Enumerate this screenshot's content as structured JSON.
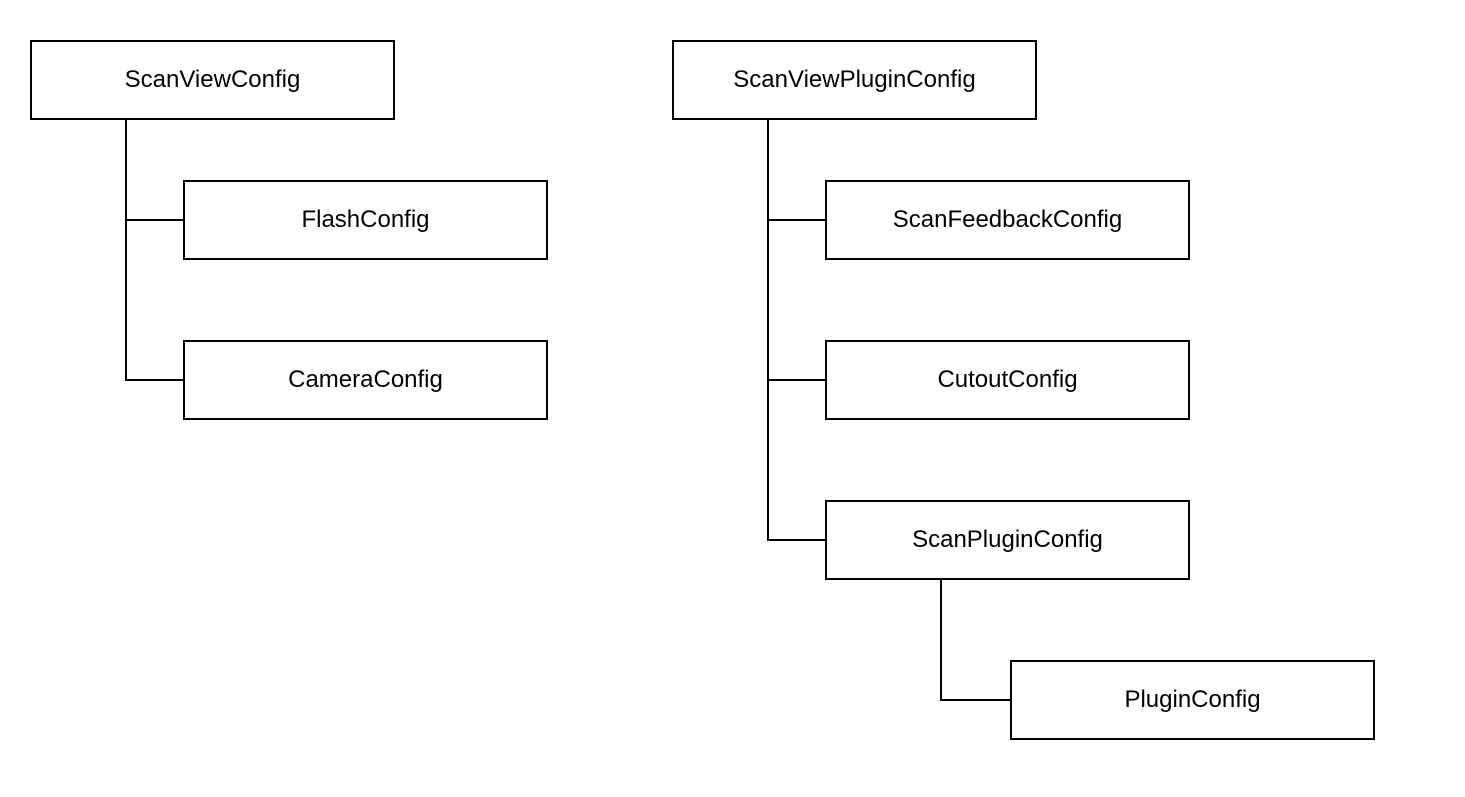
{
  "left": {
    "root": "ScanViewConfig",
    "children": [
      "FlashConfig",
      "CameraConfig"
    ]
  },
  "right": {
    "root": "ScanViewPluginConfig",
    "children": [
      "ScanFeedbackConfig",
      "CutoutConfig",
      "ScanPluginConfig"
    ],
    "grandchild": "PluginConfig"
  }
}
